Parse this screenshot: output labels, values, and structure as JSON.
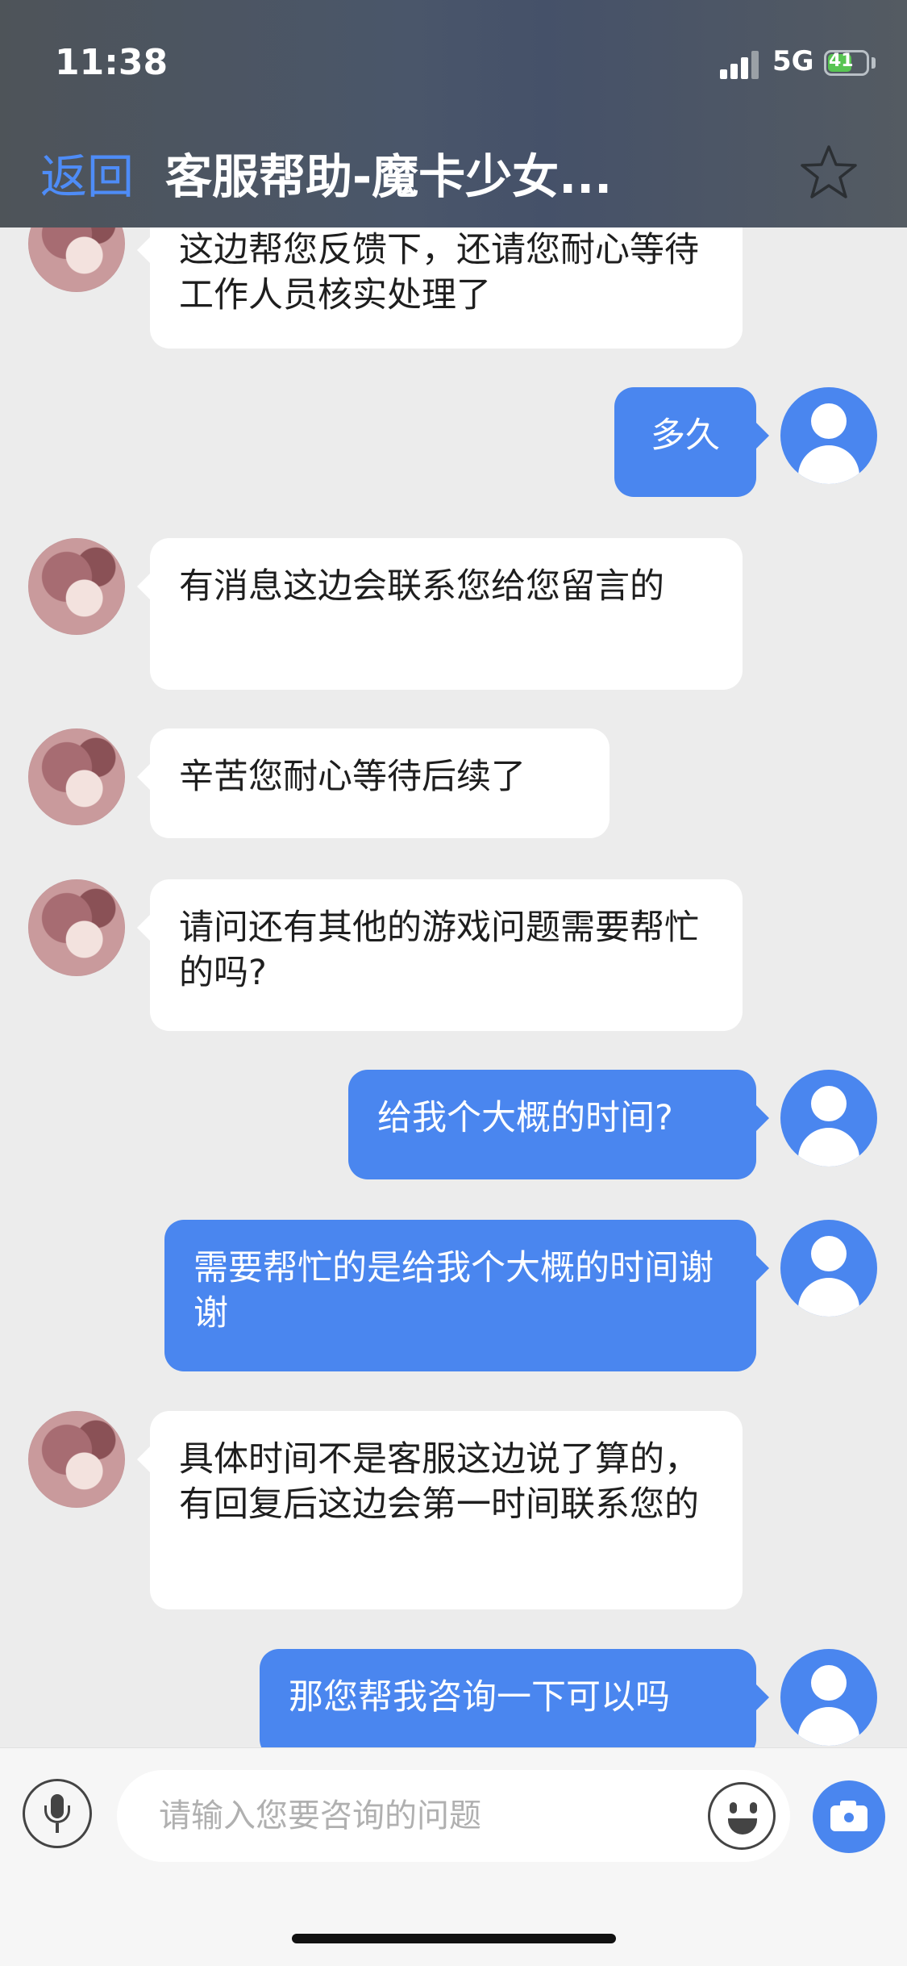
{
  "status_bar": {
    "time": "11:38",
    "network": "5G",
    "battery": "41"
  },
  "nav": {
    "back_label": "返回",
    "title": "客服帮助-魔卡少女..."
  },
  "messages": [
    {
      "from": "agent",
      "text": "这边帮您反馈下，还请您耐心等待工作人员核实处理了"
    },
    {
      "from": "user",
      "text": "多久"
    },
    {
      "from": "agent",
      "text": "有消息这边会联系您给您留言的"
    },
    {
      "from": "agent",
      "text": "辛苦您耐心等待后续了"
    },
    {
      "from": "agent",
      "text": "请问还有其他的游戏问题需要帮忙的吗?"
    },
    {
      "from": "user",
      "text": "给我个大概的时间?"
    },
    {
      "from": "user",
      "text": "需要帮忙的是给我个大概的时间谢谢"
    },
    {
      "from": "agent",
      "text": "具体时间不是客服这边说了算的，有回复后这边会第一时间联系您的"
    },
    {
      "from": "user",
      "text": "那您帮我咨询一下可以吗"
    }
  ],
  "input": {
    "placeholder": "请输入您要咨询的问题"
  },
  "colors": {
    "accent": "#4a86ef",
    "header_bg": "#4e5459",
    "chat_bg": "#ececec"
  }
}
